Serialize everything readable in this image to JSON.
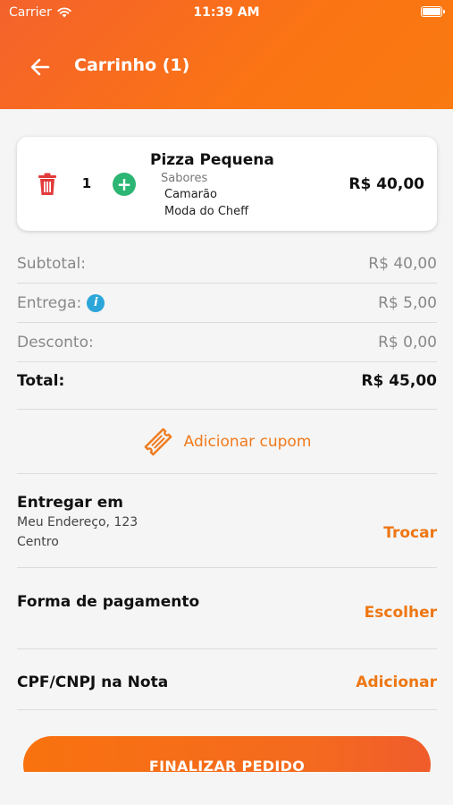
{
  "status_bar": {
    "carrier": "Carrier",
    "time": "11:39 AM"
  },
  "header": {
    "title": "Carrinho (1)"
  },
  "cart_item": {
    "quantity": "1",
    "name": "Pizza Pequena",
    "flavors_label": "Sabores",
    "flavors": [
      "Camarão",
      "Moda do Cheff"
    ],
    "price": "R$ 40,00"
  },
  "summary": {
    "subtotal": {
      "label": "Subtotal:",
      "value": "R$ 40,00"
    },
    "delivery": {
      "label": "Entrega:",
      "value": "R$ 5,00"
    },
    "discount": {
      "label": "Desconto:",
      "value": "R$ 0,00"
    },
    "total": {
      "label": "Total:",
      "value": "R$ 45,00"
    }
  },
  "coupon": {
    "label": "Adicionar cupom"
  },
  "delivery_address": {
    "title": "Entregar em",
    "lines": [
      "Meu Endereço, 123",
      "Centro"
    ],
    "action": "Trocar"
  },
  "payment": {
    "title": "Forma de pagamento",
    "action": "Escolher"
  },
  "tax_id": {
    "title": "CPF/CNPJ na Nota",
    "action": "Adicionar"
  },
  "finalize": {
    "label": "FINALIZAR PEDIDO"
  },
  "colors": {
    "accent": "#f97316",
    "success": "#2bb673",
    "info": "#2ca6d9",
    "danger": "#e23b3b"
  }
}
